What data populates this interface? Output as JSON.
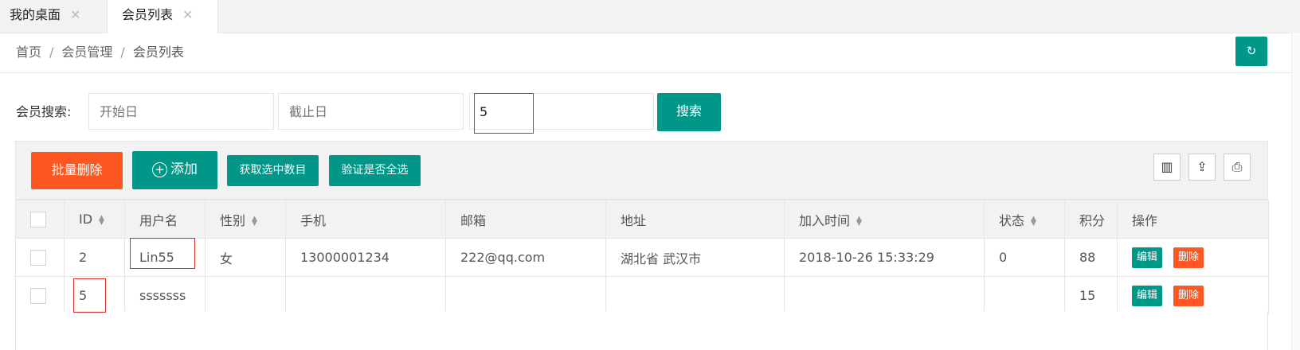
{
  "tabs": [
    {
      "label": "我的桌面",
      "close": "✕"
    },
    {
      "label": "会员列表",
      "close": "✕"
    }
  ],
  "breadcrumb": {
    "home": "首页",
    "section": "会员管理",
    "current": "会员列表",
    "separator": "/"
  },
  "refresh_icon": "refresh-icon",
  "search": {
    "label": "会员搜索:",
    "start_placeholder": "开始日",
    "end_placeholder": "截止日",
    "keyword_value": "5",
    "button": "搜索"
  },
  "toolbar": {
    "batch_delete": "批量删除",
    "add": "添加",
    "get_selected": "获取选中数目",
    "verify_all": "验证是否全选",
    "icons": [
      "columns-icon",
      "export-icon",
      "print-icon"
    ]
  },
  "table": {
    "headers": [
      "ID",
      "用户名",
      "性别",
      "手机",
      "邮箱",
      "地址",
      "加入时间",
      "状态",
      "积分",
      "操作"
    ],
    "rows": [
      {
        "id": "2",
        "username": "Lin55",
        "gender": "女",
        "phone": "13000001234",
        "email": "222@qq.com",
        "address": "湖北省 武汉市",
        "joined": "2018-10-26 15:33:29",
        "status": "0",
        "points": "88"
      },
      {
        "id": "5",
        "username": "sssssss",
        "gender": "",
        "phone": "",
        "email": "",
        "address": "",
        "joined": "",
        "status": "",
        "points": "15"
      }
    ],
    "edit_label": "编辑",
    "delete_label": "删除"
  },
  "colors": {
    "primary": "#009688",
    "danger": "#ff5722",
    "highlight": "#d0302a"
  }
}
